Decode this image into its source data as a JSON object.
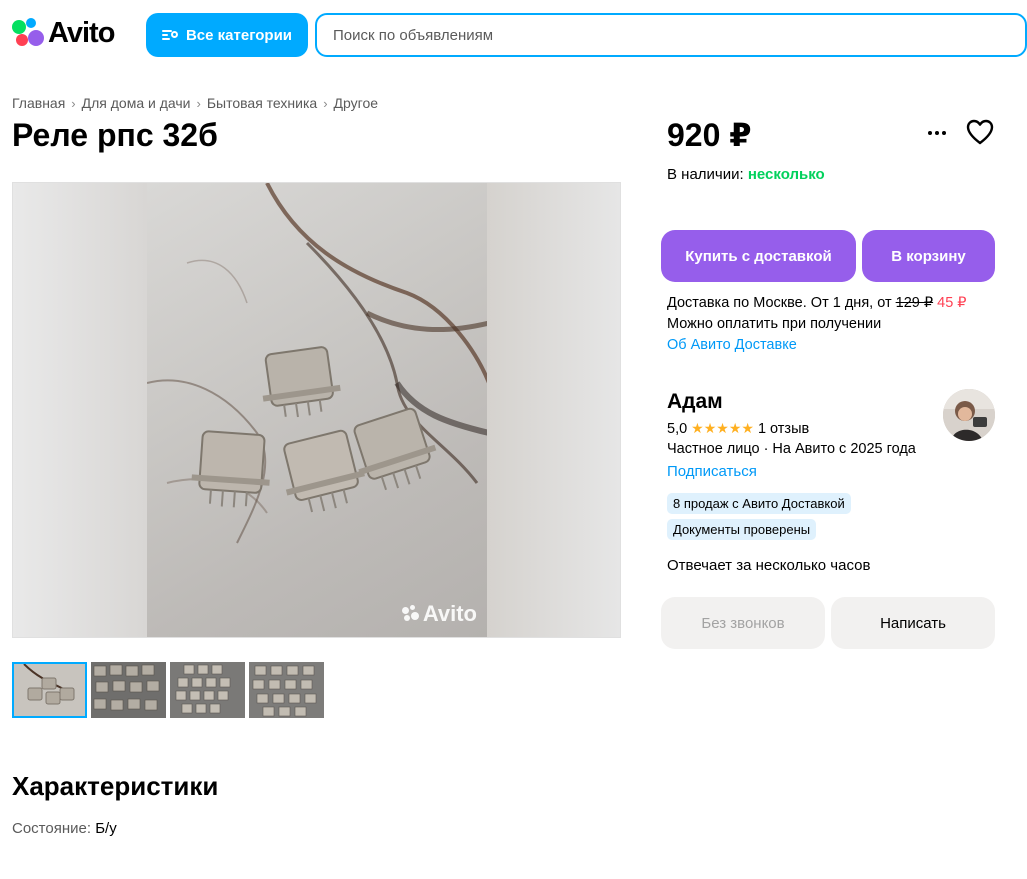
{
  "header": {
    "logo_text": "Avito",
    "categories_button": "Все категории",
    "search_placeholder": "Поиск по объявлениям"
  },
  "breadcrumb": [
    "Главная",
    "Для дома и дачи",
    "Бытовая техника",
    "Другое"
  ],
  "listing": {
    "title": "Реле рпс 32б",
    "price": "920 ₽",
    "availability_label": "В наличии:",
    "availability_value": "несколько",
    "photo_watermark": "Avito",
    "thumbnail_count": 4,
    "active_thumbnail": 1
  },
  "actions": {
    "buy_delivery": "Купить с доставкой",
    "add_to_cart": "В корзину"
  },
  "delivery": {
    "text": "Доставка по Москве. От 1 дня, от",
    "old_price": "129 ₽",
    "new_price": "45 ₽",
    "pay_on_receipt": "Можно оплатить при получении",
    "about_link": "Об Авито Доставке"
  },
  "seller": {
    "name": "Адам",
    "rating": "5,0",
    "stars": "★★★★★",
    "reviews": "1 отзыв",
    "info": "Частное лицо · На Авито с 2025 года",
    "subscribe": "Подписаться",
    "badges": [
      "8 продаж с Авито Доставкой",
      "Документы проверены"
    ],
    "responds": "Отвечает за несколько часов"
  },
  "contact": {
    "no_calls": "Без звонков",
    "write": "Написать"
  },
  "characteristics": {
    "title": "Характеристики",
    "items": [
      {
        "label": "Состояние:",
        "value": "Б/у"
      }
    ]
  },
  "colors": {
    "accent_blue": "#00aaff",
    "purple": "#965eeb",
    "green": "#02d15c",
    "red": "#ff4053",
    "link": "#0099f7"
  },
  "icons": {
    "more": "more-horizontal-icon",
    "favorite": "heart-icon",
    "categories": "categories-search-icon",
    "breadcrumb_sep": "chevron-right-icon"
  }
}
